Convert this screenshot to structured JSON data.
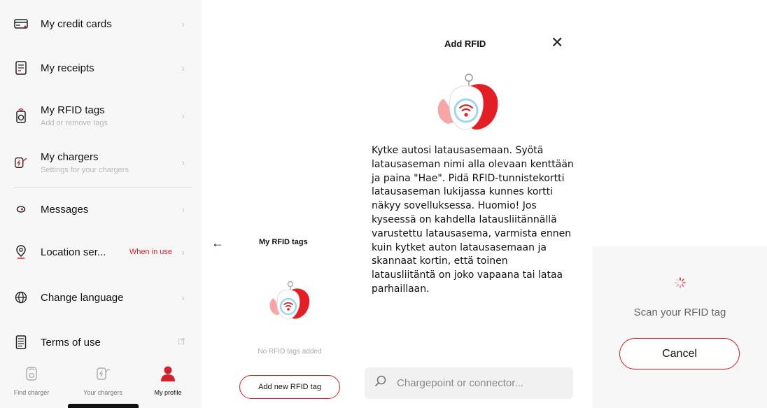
{
  "profile_menu": {
    "items": [
      {
        "label": "My credit cards",
        "icon": "credit-card-icon"
      },
      {
        "label": "My receipts",
        "icon": "receipt-icon"
      },
      {
        "label": "My RFID tags",
        "sub": "Add or remove tags",
        "icon": "rfid-tag-icon"
      },
      {
        "label": "My chargers",
        "sub": "Settings for your chargers",
        "icon": "charger-icon"
      },
      {
        "label": "Messages",
        "icon": "message-icon"
      },
      {
        "label": "Location ser...",
        "status": "When in use",
        "icon": "location-pin-icon"
      },
      {
        "label": "Change language",
        "icon": "globe-icon"
      },
      {
        "label": "Terms of use",
        "icon": "document-icon"
      }
    ]
  },
  "bottom_nav": {
    "tabs": [
      {
        "label": "Find charger",
        "icon": "find-charger-icon"
      },
      {
        "label": "Your chargers",
        "icon": "your-chargers-icon"
      },
      {
        "label": "My profile",
        "icon": "profile-icon",
        "active": true
      }
    ]
  },
  "rfid_tags_screen": {
    "title": "My RFID tags",
    "empty_text": "No RFID tags added",
    "add_button": "Add new RFID tag"
  },
  "add_rfid_screen": {
    "title": "Add RFID",
    "instructions": "Kytke autosi latausasemaan. Syötä latausaseman nimi alla olevaan kenttään ja paina \"Hae\". Pidä RFID-tunnistekortti latausaseman lukijassa kunnes kortti näkyy sovelluksessa. Huomio! Jos kyseessä on kahdella latausliitännällä varustettu latausasema, varmista ennen kuin kytket auton latausasemaan ja skannaat kortin, että toinen latausliitäntä on joko vapaana tai lataa parhaillaan.",
    "search_placeholder": "Chargepoint or connector..."
  },
  "scan_screen": {
    "status_text": "Scan your RFID tag",
    "cancel_button": "Cancel"
  },
  "colors": {
    "accent": "#d4202a",
    "background_panel": "#f7f7f7"
  }
}
